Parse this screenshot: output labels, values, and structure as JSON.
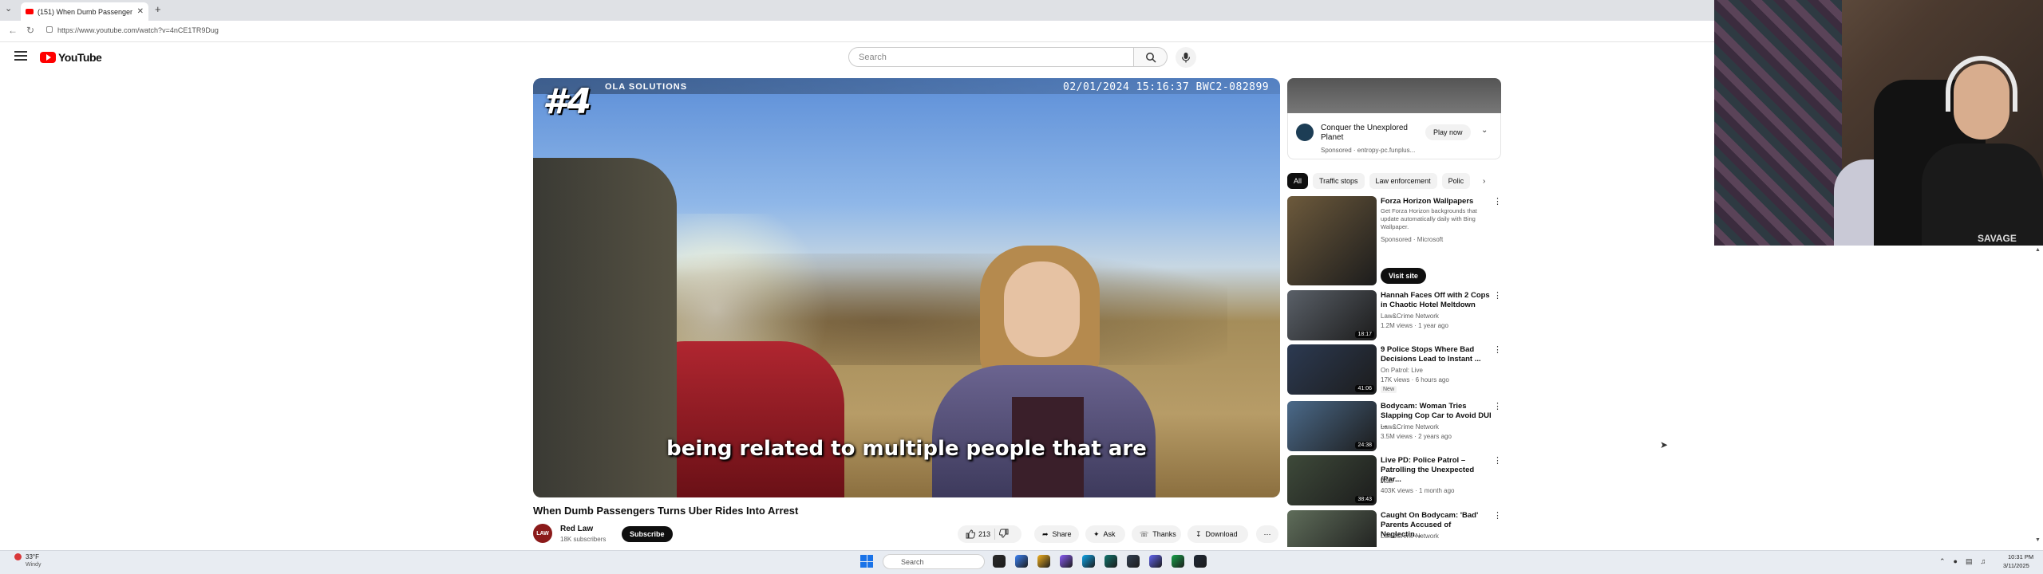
{
  "browser": {
    "tab_title": "(151) When Dumb Passenger",
    "url": "https://www.youtube.com/watch?v=4nCE1TR9Dug",
    "new_tab": "+"
  },
  "header": {
    "logo_text": "YouTube",
    "search_placeholder": "Search"
  },
  "video": {
    "rank": "#4",
    "cam_brand": "OLA SOLUTIONS",
    "cam_timestamp": "02/01/2024 15:16:37 BWC2-082899",
    "subtitle": "being related to multiple people that are",
    "title": "When Dumb Passengers Turns Uber Rides Into Arrest",
    "channel_name": "Red Law",
    "channel_avatar": "LAW",
    "channel_subs": "18K subscribers",
    "subscribe_label": "Subscribe",
    "like_count": "213",
    "share_label": "Share",
    "ask_label": "Ask",
    "thanks_label": "Thanks",
    "download_label": "Download"
  },
  "sidebar": {
    "ad": {
      "title": "Conquer the Unexplored Planet",
      "sponsored": "Sponsored · entropy-pc.funplus...",
      "play_label": "Play now"
    },
    "chips": [
      "All",
      "Traffic stops",
      "Law enforcement",
      "Polic"
    ],
    "recommendations": [
      {
        "title": "Forza Horizon Wallpapers",
        "channel": "Get Forza Horizon backgrounds that update automatically daily with Bing Wallpaper.",
        "meta": "Sponsored · Microsoft",
        "duration": "",
        "action": "Visit site",
        "thumb_color": "#6d5a3c"
      },
      {
        "title": "Hannah Faces Off with 2 Cops in Chaotic Hotel Meltdown",
        "channel": "Law&Crime Network",
        "meta": "1.2M views · 1 year ago",
        "duration": "18:17",
        "thumb_color": "#5a6068"
      },
      {
        "title": "9 Police Stops Where Bad Decisions Lead to Instant ...",
        "channel": "On Patrol: Live",
        "meta": "17K views · 6 hours ago",
        "duration": "41:06",
        "tag": "New",
        "thumb_color": "#2c3a52"
      },
      {
        "title": "Bodycam: Woman Tries Slapping Cop Car to Avoid DUI ...",
        "channel": "Law&Crime Network",
        "meta": "3.5M views · 2 years ago",
        "duration": "24:38",
        "thumb_color": "#4b6a8a"
      },
      {
        "title": "Live PD: Police Patrol – Patrolling the Unexpected (Par...",
        "channel": "A&E",
        "meta": "403K views · 1 month ago",
        "duration": "38:43",
        "thumb_color": "#3e4a3a"
      },
      {
        "title": "Caught On Bodycam: 'Bad' Parents Accused of Neglectin...",
        "channel": "Law&Crime Network",
        "meta": "",
        "duration": "",
        "thumb_color": "#5f6d5a"
      }
    ]
  },
  "webcam": {
    "shirt_text": "SAVAGE"
  },
  "taskbar": {
    "weather_temp": "33°F",
    "weather_desc": "Windy",
    "search_label": "Search",
    "time": "10:31 PM",
    "date": "3/11/2025",
    "apps": [
      "#2b2b2b",
      "#3b82f6",
      "#f2b01e",
      "#8b5cf6",
      "#0ea5e9",
      "#0f766e",
      "#334155",
      "#6366f1",
      "#16a34a",
      "#1f2937"
    ]
  },
  "colors": {
    "brand_red": "#ff0000",
    "taskbar_bg": "#e8ecf2"
  }
}
